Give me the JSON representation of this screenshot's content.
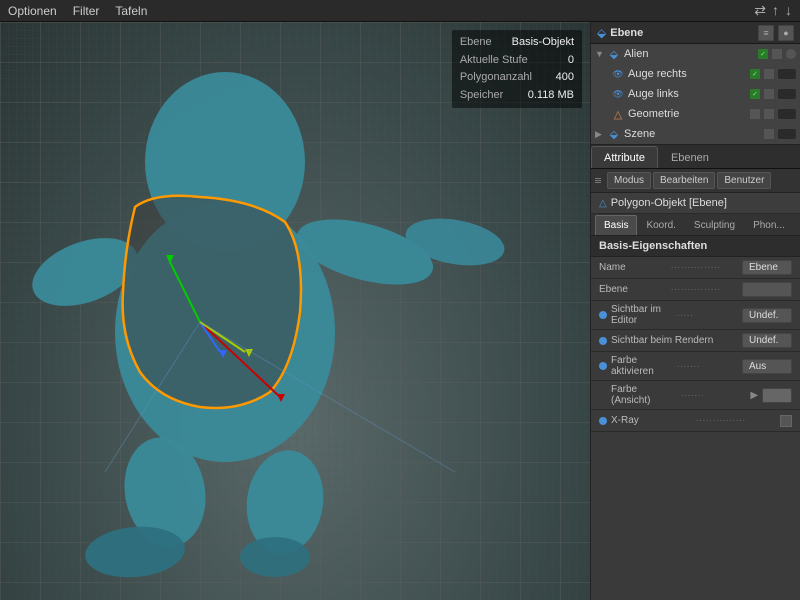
{
  "menubar": {
    "items": [
      "Optionen",
      "Filter",
      "Tafeln"
    ],
    "icons": [
      "⇄",
      "↑",
      "↓"
    ]
  },
  "viewport": {
    "info": {
      "rows": [
        {
          "label": "Ebene",
          "value": "Basis-Objekt"
        },
        {
          "label": "Aktuelle Stufe",
          "value": "0"
        },
        {
          "label": "Polygonanzahl",
          "value": "400"
        },
        {
          "label": "Speicher",
          "value": "0.118 MB"
        }
      ]
    }
  },
  "scene_panel": {
    "title": "Ebene",
    "items": [
      {
        "indent": 0,
        "icon": "layer",
        "label": "Alien",
        "has_children": true,
        "dots": [
          "check",
          "grey",
          "grey"
        ]
      },
      {
        "indent": 1,
        "icon": "eye",
        "label": "Auge rechts",
        "has_children": false,
        "dots": [
          "check",
          "grey",
          "grey"
        ]
      },
      {
        "indent": 1,
        "icon": "eye",
        "label": "Auge links",
        "has_children": false,
        "dots": [
          "check",
          "grey",
          "grey"
        ]
      },
      {
        "indent": 1,
        "icon": "geo",
        "label": "Geometrie",
        "has_children": false,
        "dots": [
          "grey",
          "grey",
          "grey"
        ]
      },
      {
        "indent": 0,
        "icon": "layer",
        "label": "Szene",
        "has_children": false,
        "dots": [
          "grey",
          "grey"
        ]
      }
    ]
  },
  "attr_panel": {
    "tabs": [
      {
        "label": "Attribute",
        "active": true
      },
      {
        "label": "Ebenen",
        "active": false
      }
    ],
    "toolbar": {
      "items": [
        "Modus",
        "Bearbeiten",
        "Benutzer"
      ]
    },
    "object_title": "Polygon-Objekt [Ebene]",
    "sub_tabs": [
      {
        "label": "Basis",
        "active": true
      },
      {
        "label": "Koord.",
        "active": false
      },
      {
        "label": "Sculpting",
        "active": false
      },
      {
        "label": "Phon...",
        "active": false
      }
    ],
    "section_title": "Basis-Eigenschaften",
    "properties": [
      {
        "has_indicator": false,
        "label": "Name",
        "dots": "...............",
        "value": "Ebene",
        "type": "text"
      },
      {
        "has_indicator": false,
        "label": "Ebene",
        "dots": "...............",
        "value": "",
        "type": "text"
      },
      {
        "has_indicator": true,
        "label": "Sichtbar im Editor",
        "dots": ".....",
        "value": "Undef.",
        "type": "text"
      },
      {
        "has_indicator": true,
        "label": "Sichtbar beim Rendern",
        "dots": "",
        "value": "Undef.",
        "type": "text"
      },
      {
        "has_indicator": true,
        "label": "Farbe aktivieren",
        "dots": ".......",
        "value": "Aus",
        "type": "text"
      },
      {
        "has_indicator": false,
        "label": "Farbe (Ansicht)",
        "dots": ".......",
        "value": "▶",
        "type": "arrow"
      },
      {
        "has_indicator": true,
        "label": "X-Ray",
        "dots": "...............",
        "value": "",
        "type": "checkbox"
      }
    ]
  }
}
